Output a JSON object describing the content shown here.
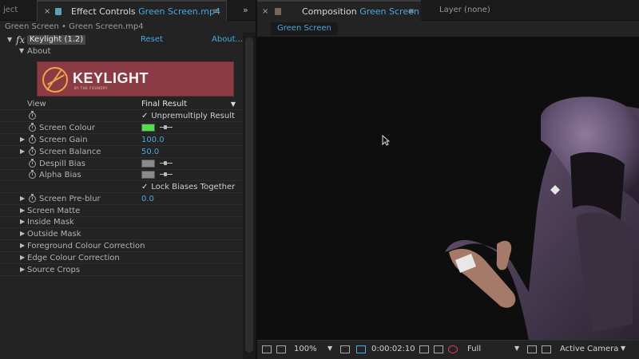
{
  "left_panel": {
    "project_tab_label": "ject",
    "effect_controls_tab": {
      "close": "×",
      "title": "Effect Controls",
      "file": "Green Screen.mp4",
      "menu": "≡"
    },
    "panel_arrows": "»",
    "header_path": "Green Screen • Green Screen.mp4",
    "effect": {
      "fx_glyph": "fx",
      "name": "Keylight (1.2)",
      "reset": "Reset",
      "about": "About...",
      "about_group": "About",
      "banner_text": "KEYLIGHT",
      "banner_sub": "BY THE FOUNDRY"
    },
    "props": {
      "view_label": "View",
      "view_value": "Final Result",
      "unpremultiply_label": "Unpremultiply Result",
      "screen_colour_label": "Screen Colour",
      "screen_colour": "#52e04a",
      "screen_gain_label": "Screen Gain",
      "screen_gain_value": "100.0",
      "screen_balance_label": "Screen Balance",
      "screen_balance_value": "50.0",
      "despill_bias_label": "Despill Bias",
      "despill_colour": "#8a8a8a",
      "alpha_bias_label": "Alpha Bias",
      "alpha_colour": "#8a8a8a",
      "lock_biases_label": "Lock Biases Together",
      "screen_preblur_label": "Screen Pre-blur",
      "screen_preblur_value": "0.0",
      "check_mark": "✓"
    },
    "groups": {
      "screen_matte": "Screen Matte",
      "inside_mask": "Inside Mask",
      "outside_mask": "Outside Mask",
      "foreground_cc": "Foreground Colour Correction",
      "edge_cc": "Edge Colour Correction",
      "source_crops": "Source Crops"
    }
  },
  "right_panel": {
    "composition_tab": {
      "close": "×",
      "title": "Composition",
      "name": "Green Screen",
      "menu": "≡"
    },
    "layer_tab": "Layer (none)",
    "comp_subtab": "Green Screen",
    "viewer_bar": {
      "zoom": "100%",
      "timecode": "0:00:02:10",
      "resolution": "Full",
      "camera": "Active Camera"
    }
  },
  "colors": {
    "accent_blue": "#4aa8e0",
    "banner_red": "#8a3b43"
  }
}
